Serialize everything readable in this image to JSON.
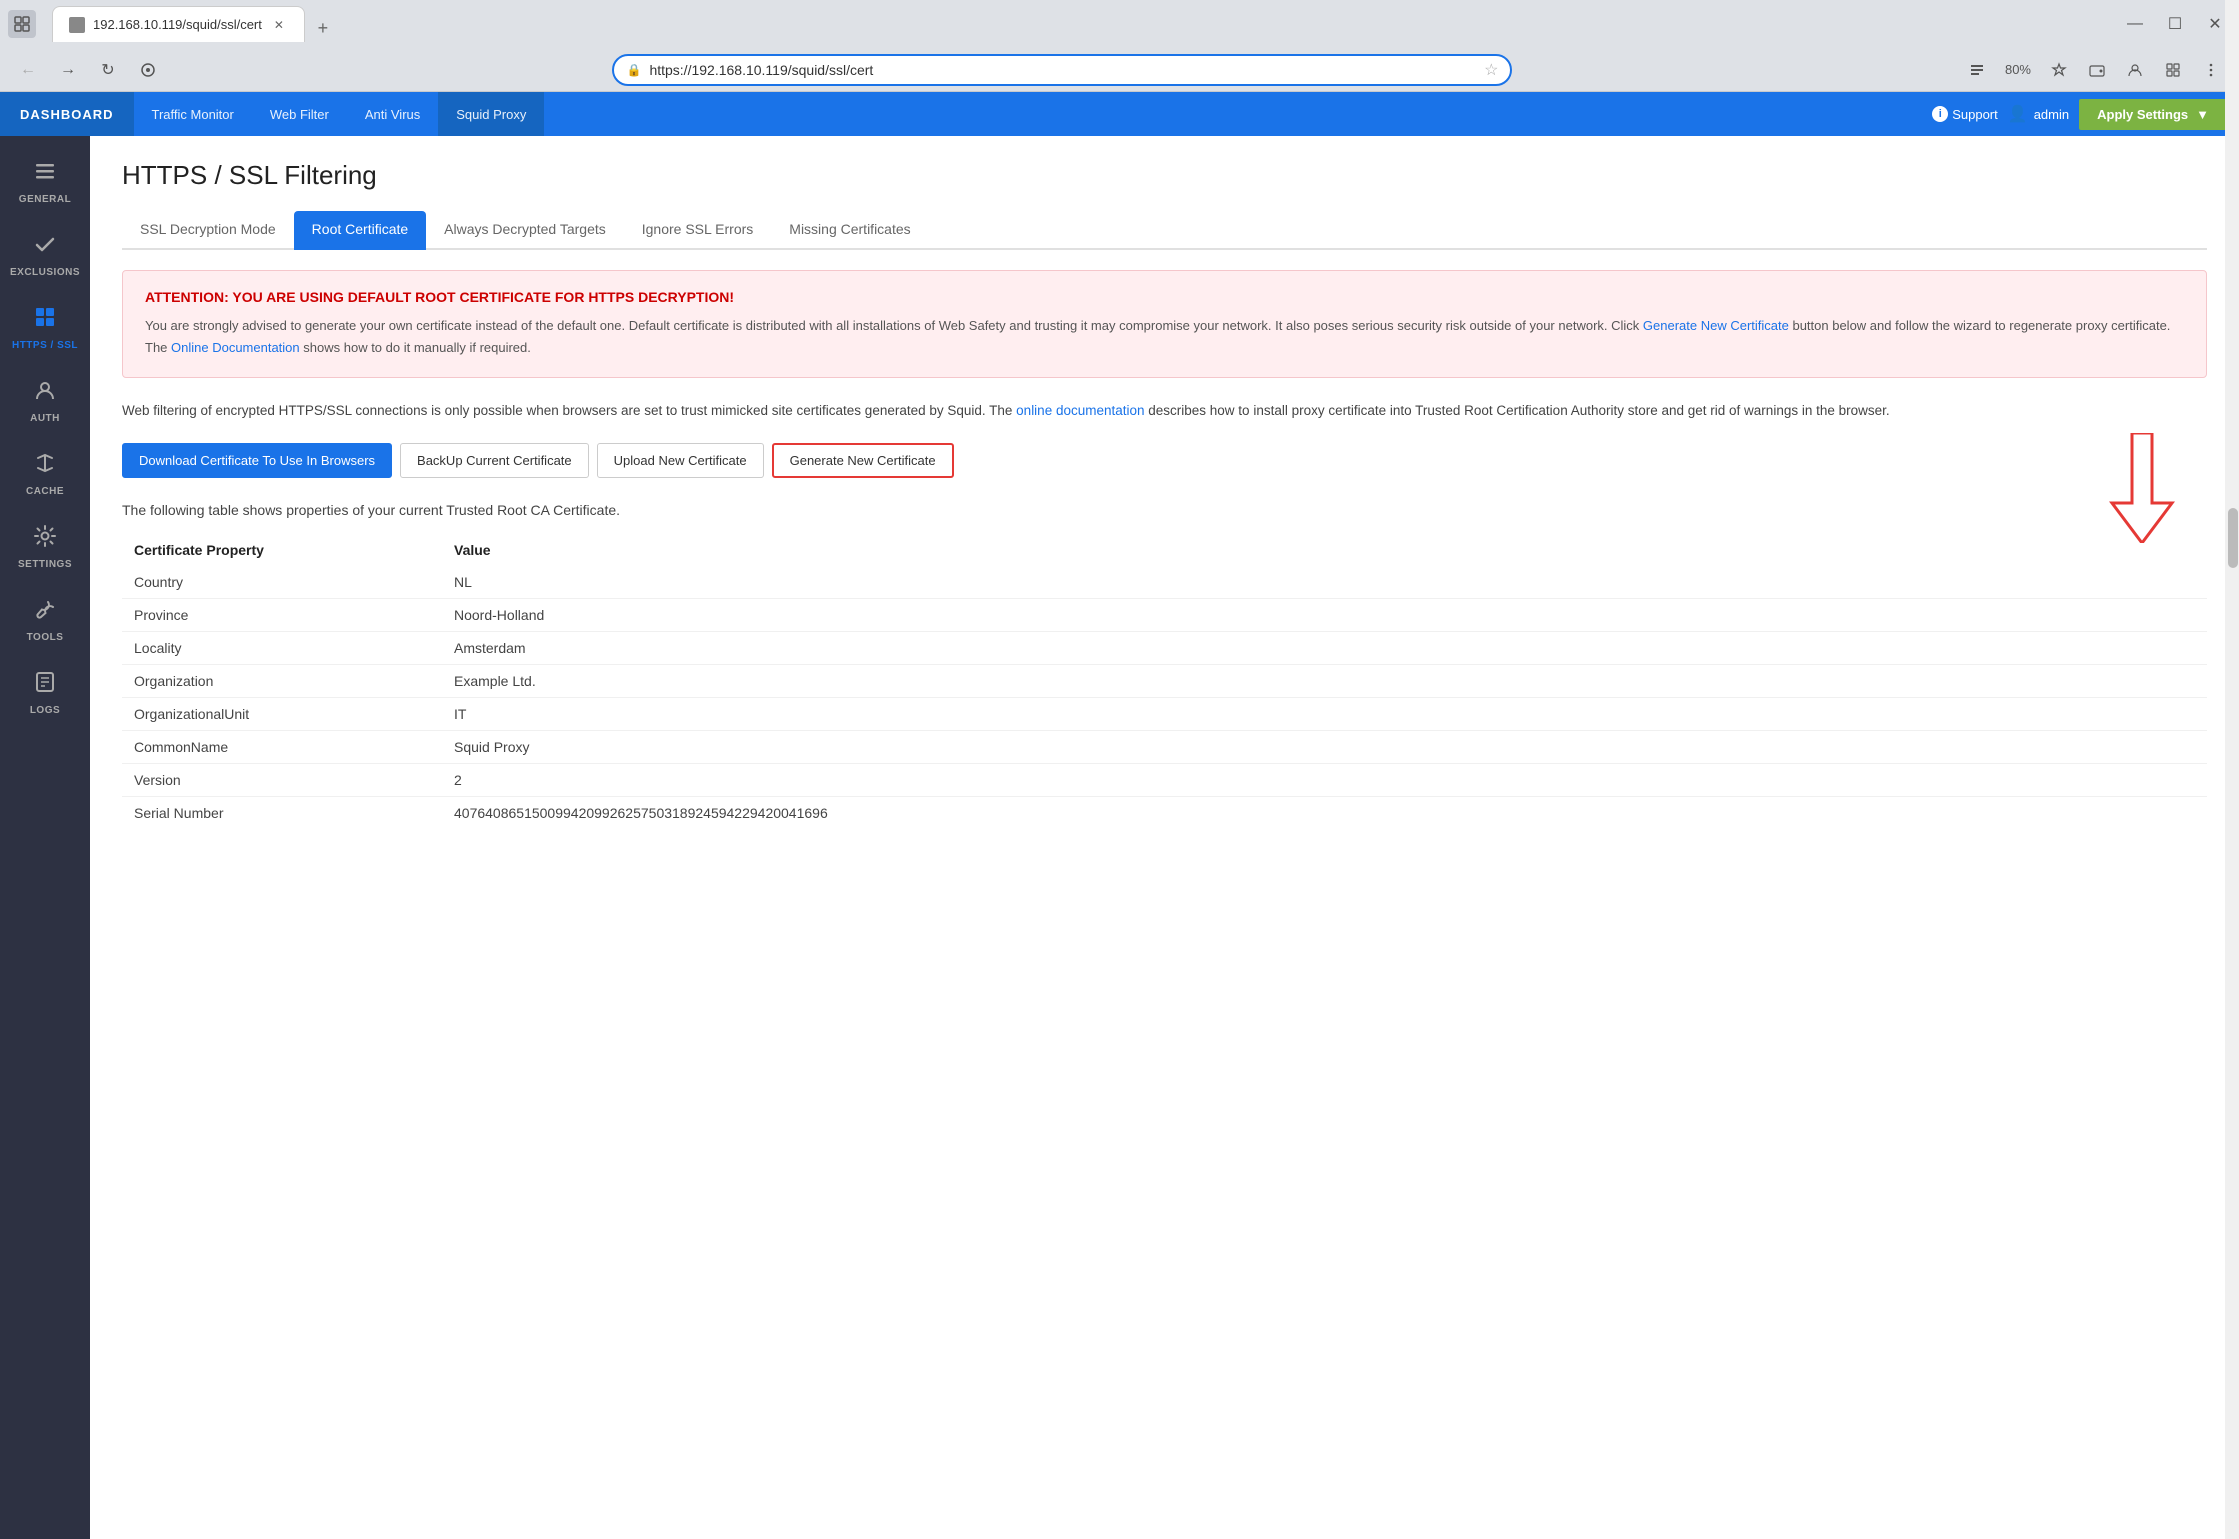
{
  "browser": {
    "tab": {
      "title": "192.168.10.119/squid/ssl/cert",
      "favicon": "□"
    },
    "url": "https://192.168.10.119/squid/ssl/cert",
    "zoom": "80%"
  },
  "navbar": {
    "logo": "DASHBOARD",
    "items": [
      {
        "label": "Traffic Monitor",
        "active": false
      },
      {
        "label": "Web Filter",
        "active": false
      },
      {
        "label": "Anti Virus",
        "active": false
      },
      {
        "label": "Squid Proxy",
        "active": true
      }
    ],
    "support": "Support",
    "admin": "admin",
    "apply_settings": "Apply Settings"
  },
  "sidebar": {
    "items": [
      {
        "label": "GENERAL",
        "icon": "☰"
      },
      {
        "label": "EXCLUSIONS",
        "icon": "✓"
      },
      {
        "label": "HTTPS / SSL",
        "icon": "⊞",
        "active": true
      },
      {
        "label": "AUTH",
        "icon": "👤"
      },
      {
        "label": "CACHE",
        "icon": "⬇"
      },
      {
        "label": "SETTINGS",
        "icon": "⚙"
      },
      {
        "label": "TOOLS",
        "icon": "🔧"
      },
      {
        "label": "LOGS",
        "icon": "📁"
      }
    ]
  },
  "page": {
    "title": "HTTPS / SSL Filtering",
    "tabs": [
      {
        "label": "SSL Decryption Mode",
        "active": false
      },
      {
        "label": "Root Certificate",
        "active": true
      },
      {
        "label": "Always Decrypted Targets",
        "active": false
      },
      {
        "label": "Ignore SSL Errors",
        "active": false
      },
      {
        "label": "Missing Certificates",
        "active": false
      }
    ],
    "alert": {
      "title": "ATTENTION: YOU ARE USING DEFAULT ROOT CERTIFICATE FOR HTTPS DECRYPTION!",
      "text_1": "You are strongly advised to generate your own certificate instead of the default one. Default certificate is distributed with all installations of Web Safety and trusting it may compromise your network. It also poses serious security risk outside of your network. Click ",
      "link_text": "Generate New Certificate",
      "text_2": " button below and follow the wizard to regenerate proxy certificate. The ",
      "link_text_2": "Online Documentation",
      "text_3": " shows how to do it manually if required."
    },
    "description": {
      "text_1": "Web filtering of encrypted HTTPS/SSL connections is only possible when browsers are set to trust mimicked site certificates generated by Squid. The ",
      "link_text": "online documentation",
      "text_2": " describes how to install proxy certificate into Trusted Root Certification Authority store and get rid of warnings in the browser."
    },
    "buttons": [
      {
        "label": "Download Certificate To Use In Browsers",
        "type": "primary"
      },
      {
        "label": "BackUp Current Certificate",
        "type": "default"
      },
      {
        "label": "Upload New Certificate",
        "type": "default"
      },
      {
        "label": "Generate New Certificate",
        "type": "highlighted"
      }
    ],
    "table_desc": "The following table shows properties of your current Trusted Root CA Certificate.",
    "table": {
      "headers": [
        "Certificate Property",
        "Value"
      ],
      "rows": [
        {
          "property": "Country",
          "value": "NL"
        },
        {
          "property": "Province",
          "value": "Noord-Holland"
        },
        {
          "property": "Locality",
          "value": "Amsterdam"
        },
        {
          "property": "Organization",
          "value": "Example Ltd."
        },
        {
          "property": "OrganizationalUnit",
          "value": "IT"
        },
        {
          "property": "CommonName",
          "value": "Squid Proxy"
        },
        {
          "property": "Version",
          "value": "2"
        },
        {
          "property": "Serial Number",
          "value": "407640865150099420992625750318924594229420041696"
        }
      ]
    }
  }
}
